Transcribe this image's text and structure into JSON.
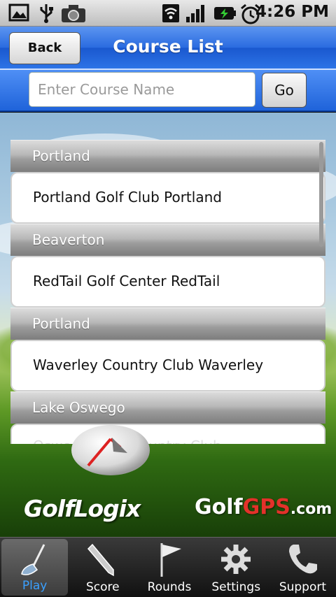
{
  "status_bar": {
    "time": "4:26 PM",
    "icons": [
      "image-icon",
      "usb-icon",
      "camera-icon",
      "wifi-icon",
      "signal-icon",
      "battery-charging-icon",
      "alarm-icon"
    ]
  },
  "header": {
    "title": "Course List",
    "back_label": "Back"
  },
  "search": {
    "placeholder": "Enter Course Name",
    "value": "",
    "go_label": "Go"
  },
  "courses": [
    {
      "city": "Portland",
      "name": "Portland Golf Club Portland"
    },
    {
      "city": "Beaverton",
      "name": "RedTail Golf Center RedTail"
    },
    {
      "city": "Portland",
      "name": "Waverley Country Club Waverley"
    },
    {
      "city": "Lake Oswego",
      "name": "Oswego Lake Country Club"
    }
  ],
  "logos": {
    "golflogix": "GolfLogix",
    "golfgps_a": "Golf",
    "golfgps_b": "GPS",
    "golfgps_c": ".com"
  },
  "tabs": [
    {
      "label": "Play",
      "icon": "golf-club-icon",
      "active": true
    },
    {
      "label": "Score",
      "icon": "pencil-icon",
      "active": false
    },
    {
      "label": "Rounds",
      "icon": "flag-icon",
      "active": false
    },
    {
      "label": "Settings",
      "icon": "gear-icon",
      "active": false
    },
    {
      "label": "Support",
      "icon": "phone-icon",
      "active": false
    }
  ],
  "colors": {
    "header_blue": "#2a6be0",
    "active_tab_label": "#3aa0ff",
    "gps_red": "#e3312a"
  }
}
